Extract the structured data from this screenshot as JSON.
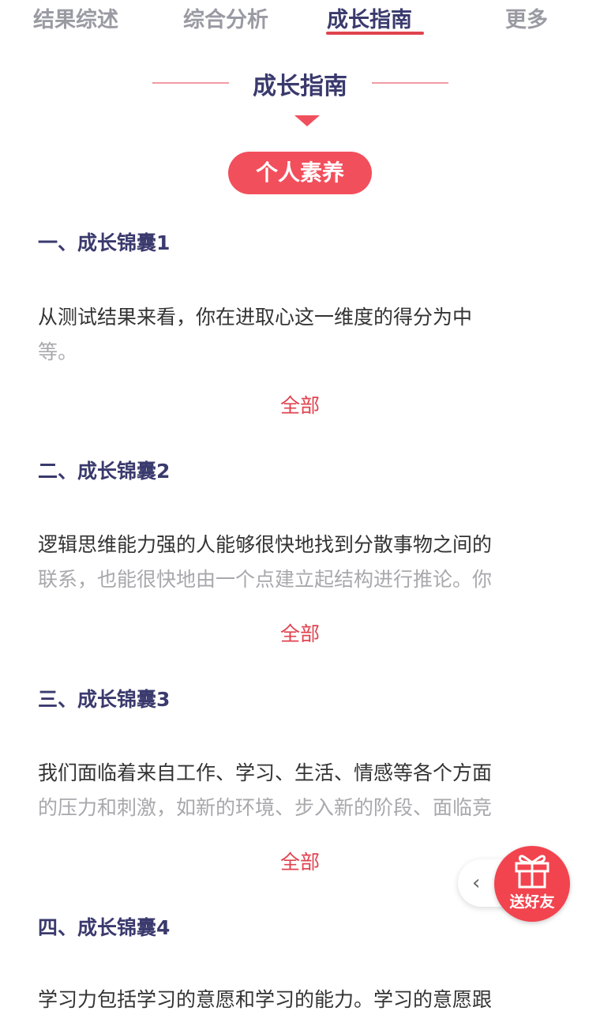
{
  "tabs": [
    {
      "label": "结果综述",
      "active": false
    },
    {
      "label": "综合分析",
      "active": false
    },
    {
      "label": "成长指南",
      "active": true
    },
    {
      "label": "更多",
      "active": false
    }
  ],
  "section": {
    "title": "成长指南",
    "pill": "个人素养"
  },
  "items": [
    {
      "heading": "一、成长锦囊1",
      "line1": "从测试结果来看，你在进取心这一维度的得分为中",
      "line2": "等。",
      "more": "全部"
    },
    {
      "heading": "二、成长锦囊2",
      "line1": "逻辑思维能力强的人能够很快地找到分散事物之间的",
      "line2": "联系，也能很快地由一个点建立起结构进行推论。你",
      "more": "全部"
    },
    {
      "heading": "三、成长锦囊3",
      "line1": "我们面临着来自工作、学习、生活、情感等各个方面",
      "line2": "的压力和刺激，如新的环境、步入新的阶段、面临竞",
      "more": "全部"
    },
    {
      "heading": "四、成长锦囊4",
      "line1": "学习力包括学习的意愿和学习的能力。学习的意愿跟",
      "line2": "",
      "more": ""
    }
  ],
  "share": {
    "label": "送好友",
    "icon": "gift-icon",
    "expand_icon": "chevron-left-icon"
  },
  "colors": {
    "accent": "#f24f5c",
    "heading": "#3a3a6e",
    "muted": "#9a9aa3"
  }
}
